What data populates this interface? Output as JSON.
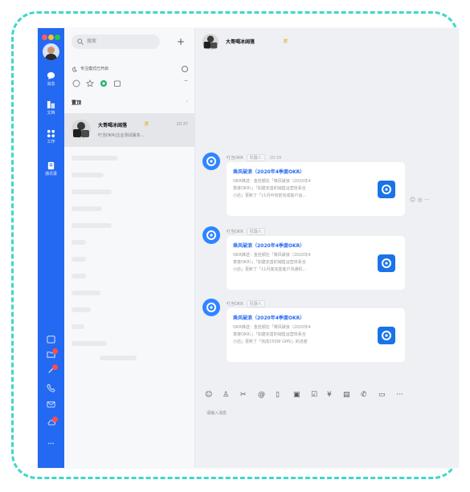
{
  "search": {
    "placeholder": "搜索"
  },
  "list": {
    "add_label": "+",
    "focus_mode": "专注模式已开启",
    "section_title": "置顶",
    "chat_item": {
      "title": "大哥喝冰阔落",
      "badge": "群",
      "time": "20:37",
      "preview": "叮当OKR(企业测试版本..."
    }
  },
  "header": {
    "title": "大哥喝冰阔落",
    "badge": "群"
  },
  "messages": [
    {
      "sender": "叮当OKR",
      "tag": "机器人",
      "time": "20:39",
      "card_title": "乘风破浪（2020年4季度OKR）",
      "body_lines": [
        "OKR推送：金佳顺在「乘风破浪（2020年4",
        "季度OKR）」「如建完善的销售运营体系全",
        "小店」更新了「11月中旬前完成客户运..."
      ]
    },
    {
      "sender": "叮当OKR",
      "tag": "机器人",
      "time": "",
      "card_title": "乘风破浪（2020年4季度OKR）",
      "body_lines": [
        "OKR推送：金佳顺在「乘风破浪（2020年4",
        "季度OKR）」「如建完善的销售运营体系全",
        "小店」更新了「11月底完善客户沟通机..."
      ]
    },
    {
      "sender": "叮当OKR",
      "tag": "机器人",
      "time": "",
      "card_title": "乘风破浪（2020年4季度OKR）",
      "body_lines": [
        "OKR推送：金佳顺在「乘风破浪（2020年4",
        "季度OKR）」「如建完善的销售运营体系全",
        "小店」更新了「完成150W GMV」的进度"
      ]
    }
  ],
  "nav": [
    {
      "label": "消息",
      "icon": "chat-bubble-icon"
    },
    {
      "label": "文档",
      "icon": "document-icon"
    },
    {
      "label": "工作",
      "icon": "apps-grid-icon"
    },
    {
      "label": "通讯录",
      "icon": "contacts-icon"
    }
  ],
  "composer": {
    "placeholder": "请输入消息"
  },
  "colors": {
    "rail": "#2469f2",
    "accent": "#2f85ff",
    "badge": "#ff4d4f",
    "border": "#3fd7c9"
  }
}
